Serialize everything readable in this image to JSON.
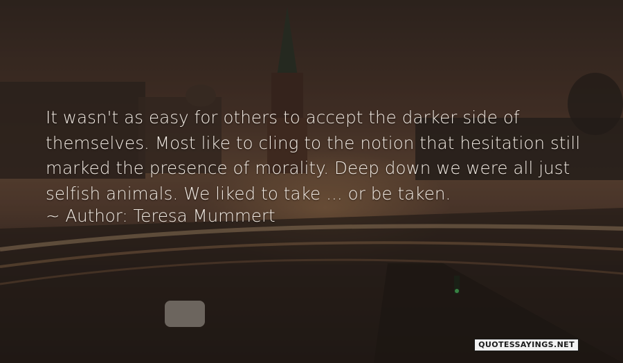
{
  "quote": {
    "lines": [
      "It wasn't as easy for others to accept the darker side of",
      "themselves. Most like to cling to the notion that hesitation still",
      "marked the presence of morality. Deep down we were all just",
      "selfish animals. We liked to take ... or be taken."
    ]
  },
  "author": {
    "prefix": "~",
    "label": "Author:",
    "name": "Teresa Mummert"
  },
  "watermark": "QUOTESSAYINGS.NET"
}
